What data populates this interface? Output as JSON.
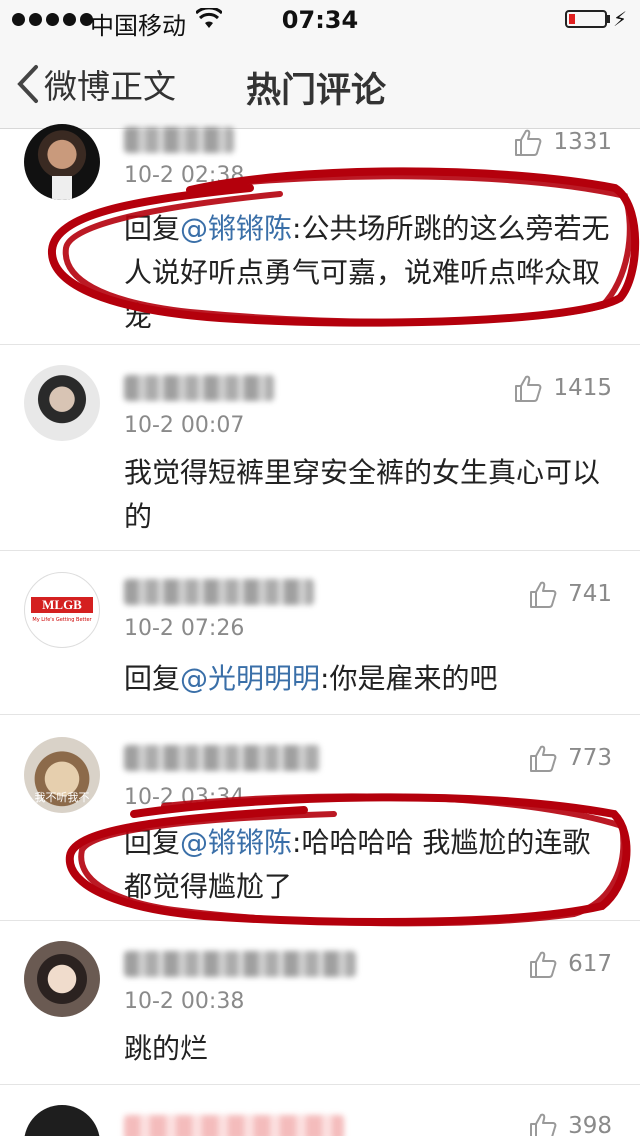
{
  "status_bar": {
    "carrier": "中国移动",
    "time": "07:34"
  },
  "nav": {
    "back_label": "微博正文",
    "title": "热门评论"
  },
  "comments": [
    {
      "time": "10-2 02:38",
      "likes": "1331",
      "prefix": "回复",
      "mention": "@锵锵陈",
      "body": ":公共场所跳的这么旁若无人说好听点勇气可嘉，说难听点哗众取宠"
    },
    {
      "time": "10-2 00:07",
      "likes": "1415",
      "prefix": "",
      "mention": "",
      "body": "我觉得短裤里穿安全裤的女生真心可以的"
    },
    {
      "time": "10-2 07:26",
      "likes": "741",
      "prefix": "回复",
      "mention": "@光明明明",
      "body": ":你是雇来的吧",
      "avatar_text": "MLGB",
      "avatar_sub": "My Life's Getting Better"
    },
    {
      "time": "10-2 03:34",
      "likes": "773",
      "prefix": "回复",
      "mention": "@锵锵陈",
      "body": ":哈哈哈哈 我尴尬的连歌都觉得尴尬了",
      "avatar_text": "我不听我不"
    },
    {
      "time": "10-2 00:38",
      "likes": "617",
      "prefix": "",
      "mention": "",
      "body": "跳的烂"
    },
    {
      "time": "",
      "likes": "398",
      "prefix": "",
      "mention": "",
      "body": ""
    }
  ],
  "colors": {
    "mention": "#3a6fa8",
    "annotation_red": "#b4000c",
    "meta_gray": "#8a8a8a"
  }
}
